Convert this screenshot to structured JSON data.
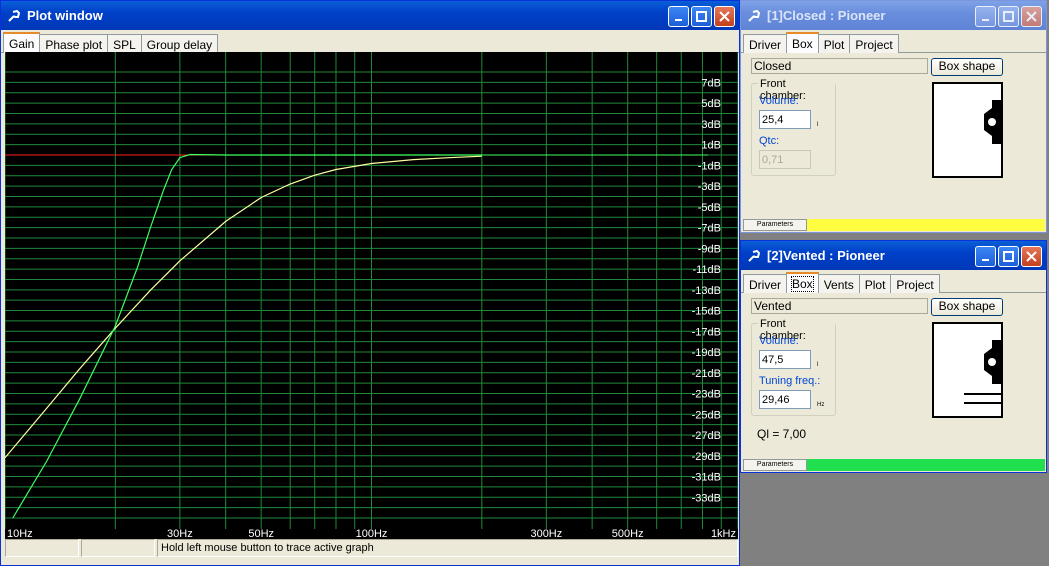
{
  "plot_window": {
    "title": "Plot window",
    "tabs": [
      "Gain",
      "Phase plot",
      "SPL",
      "Group delay"
    ],
    "active_tab": 0,
    "status": [
      "",
      "",
      "Hold left mouse button to trace active graph"
    ],
    "colors": {
      "background": "#000000",
      "grid": "#1f8a3a",
      "closed_curve": "#ffffa0",
      "vented_curve": "#40ff60",
      "reference_line": "#ff2020"
    }
  },
  "chart_data": {
    "type": "line",
    "x_scale": "log",
    "xlim": [
      10,
      1000
    ],
    "ylim": [
      -35,
      8
    ],
    "x_ticks": [
      {
        "value": 10,
        "label": "10Hz"
      },
      {
        "value": 30,
        "label": "30Hz"
      },
      {
        "value": 50,
        "label": "50Hz"
      },
      {
        "value": 100,
        "label": "100Hz"
      },
      {
        "value": 300,
        "label": "300Hz"
      },
      {
        "value": 500,
        "label": "500Hz"
      },
      {
        "value": 1000,
        "label": "1kHz"
      }
    ],
    "y_ticks": [
      {
        "value": 7,
        "label": "7dB"
      },
      {
        "value": 5,
        "label": "5dB"
      },
      {
        "value": 3,
        "label": "3dB"
      },
      {
        "value": 1,
        "label": "1dB"
      },
      {
        "value": -1,
        "label": "-1dB"
      },
      {
        "value": -3,
        "label": "-3dB"
      },
      {
        "value": -5,
        "label": "-5dB"
      },
      {
        "value": -7,
        "label": "-7dB"
      },
      {
        "value": -9,
        "label": "-9dB"
      },
      {
        "value": -11,
        "label": "-11dB"
      },
      {
        "value": -13,
        "label": "-13dB"
      },
      {
        "value": -15,
        "label": "-15dB"
      },
      {
        "value": -17,
        "label": "-17dB"
      },
      {
        "value": -19,
        "label": "-19dB"
      },
      {
        "value": -21,
        "label": "-21dB"
      },
      {
        "value": -23,
        "label": "-23dB"
      },
      {
        "value": -25,
        "label": "-25dB"
      },
      {
        "value": -27,
        "label": "-27dB"
      },
      {
        "value": -29,
        "label": "-29dB"
      },
      {
        "value": -31,
        "label": "-31dB"
      },
      {
        "value": -33,
        "label": "-33dB"
      }
    ],
    "reference_db": 0,
    "reference_x": [
      10,
      200
    ],
    "series": [
      {
        "color": "#ffffa0",
        "x": [
          10,
          13,
          16,
          20,
          25,
          30,
          40,
          50,
          60,
          70,
          80,
          100,
          130,
          160,
          200
        ],
        "y": [
          -29.2,
          -24.4,
          -20.6,
          -16.7,
          -13.0,
          -10.2,
          -6.4,
          -4.1,
          -2.8,
          -1.95,
          -1.4,
          -0.82,
          -0.45,
          -0.27,
          -0.12
        ]
      },
      {
        "color": "#40ff60",
        "x": [
          10.5,
          13,
          16,
          20,
          23,
          25,
          27,
          28.5,
          30,
          32,
          40,
          60,
          100,
          200
        ],
        "y": [
          -35,
          -29.5,
          -23.5,
          -16.5,
          -10.8,
          -6.9,
          -3.5,
          -1.4,
          -0.25,
          0.05,
          0,
          0,
          0,
          0
        ]
      }
    ]
  },
  "closed_window": {
    "title": "[1]Closed : Pioneer",
    "tabs": [
      "Driver",
      "Box",
      "Plot",
      "Project"
    ],
    "active_tab": 1,
    "box_type": "Closed",
    "box_shape_button": "Box shape",
    "group_label": "Front chamber:",
    "volume_label": "Volume:",
    "volume_value": "25,4",
    "volume_unit": "l",
    "qtc_label": "Qtc:",
    "qtc_value": "0,71",
    "params_label": "Parameters",
    "params_color": "#fffd40"
  },
  "vented_window": {
    "title": "[2]Vented : Pioneer",
    "tabs": [
      "Driver",
      "Box",
      "Vents",
      "Plot",
      "Project"
    ],
    "active_tab": 1,
    "box_type": "Vented",
    "box_shape_button": "Box shape",
    "group_label": "Front chamber:",
    "volume_label": "Volume:",
    "volume_value": "47,5",
    "volume_unit": "l",
    "tuning_label": "Tuning freq.:",
    "tuning_value": "29,46",
    "tuning_unit": "Hz",
    "ql_text": "Ql = 7,00",
    "params_label": "Parameters",
    "params_color": "#20e050"
  }
}
